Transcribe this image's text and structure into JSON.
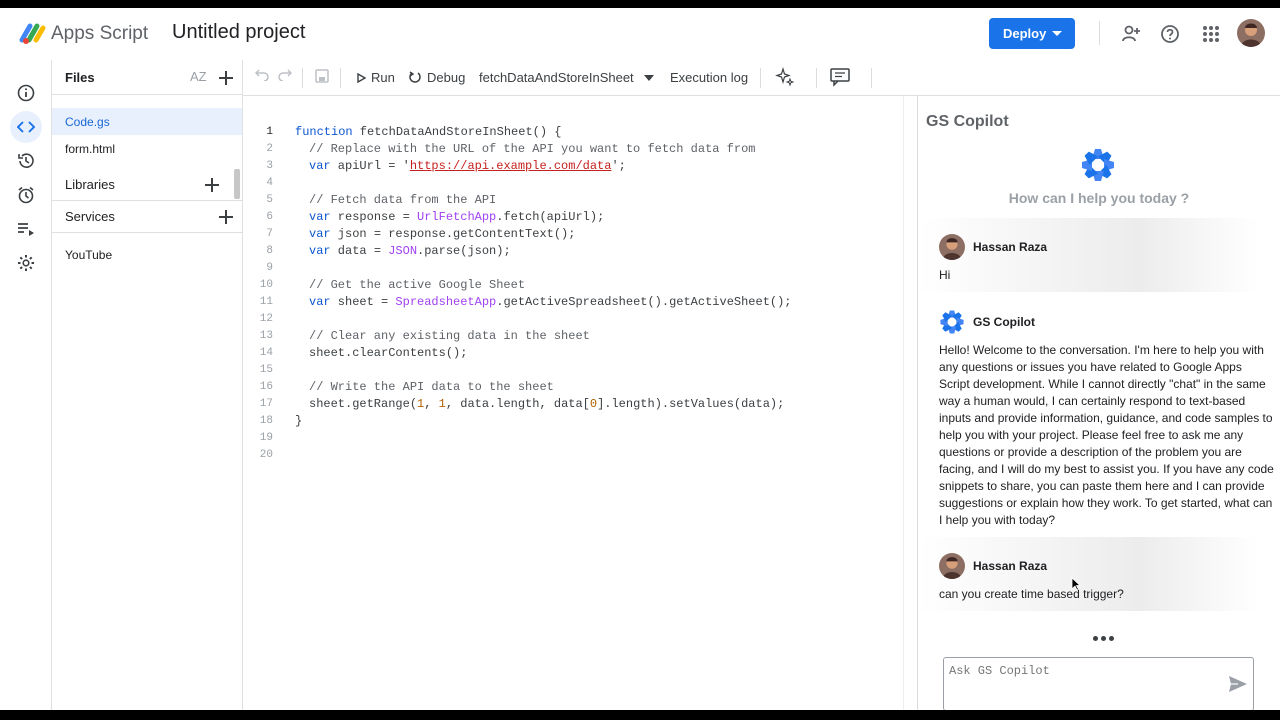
{
  "header": {
    "app_name": "Apps Script",
    "project_title": "Untitled project",
    "deploy_label": "Deploy",
    "icons": [
      "share-person-icon",
      "help-icon",
      "apps-grid-icon",
      "account-avatar"
    ]
  },
  "rail": {
    "items": [
      "info-icon",
      "code-icon",
      "history-icon",
      "triggers-icon",
      "executions-icon",
      "settings-icon"
    ],
    "active": "code-icon"
  },
  "files_panel": {
    "title": "Files",
    "sort_label": "AZ",
    "files": [
      {
        "name": "Code.gs",
        "active": true
      },
      {
        "name": "form.html",
        "active": false
      }
    ],
    "libraries_label": "Libraries",
    "services_label": "Services",
    "services": [
      "YouTube"
    ]
  },
  "toolbar": {
    "run_label": "Run",
    "debug_label": "Debug",
    "function_select": "fetchDataAndStoreInSheet",
    "execution_log_label": "Execution log"
  },
  "editor": {
    "current_line": 1,
    "line_numbers": [
      "1",
      "2",
      "3",
      "4",
      "5",
      "6",
      "7",
      "8",
      "9",
      "10",
      "11",
      "12",
      "13",
      "14",
      "15",
      "16",
      "17",
      "18",
      "19",
      "20"
    ],
    "tokens": {
      "l1_kw": "function",
      "l1_rest": " fetchDataAndStoreInSheet() {",
      "l2": "// Replace with the URL of the API you want to fetch data from",
      "l3_kw": "var",
      "l3_mid": " apiUrl = '",
      "l3_url": "https://api.example.com/data",
      "l3_end": "';",
      "l5": "// Fetch data from the API",
      "l6_kw": "var",
      "l6_mid": " response = ",
      "l6_cls": "UrlFetchApp",
      "l6_end": ".fetch(apiUrl);",
      "l7_kw": "var",
      "l7_end": " json = response.getContentText();",
      "l8_kw": "var",
      "l8_mid": " data = ",
      "l8_cls": "JSON",
      "l8_end": ".parse(json);",
      "l10": "// Get the active Google Sheet",
      "l11_kw": "var",
      "l11_mid": " sheet = ",
      "l11_cls": "SpreadsheetApp",
      "l11_end": ".getActiveSpreadsheet().getActiveSheet();",
      "l13": "// Clear any existing data in the sheet",
      "l14": "sheet.clearContents();",
      "l16": "// Write the API data to the sheet",
      "l17_a": "sheet.getRange(",
      "l17_n1": "1",
      "l17_b": ", ",
      "l17_n2": "1",
      "l17_c": ", data.length, data[",
      "l17_n3": "0",
      "l17_d": "].length).setValues(data);",
      "l18": "}"
    }
  },
  "copilot": {
    "title": "GS Copilot",
    "help_prompt": "How can I help you today ?",
    "messages": [
      {
        "author": "Hassan Raza",
        "text": "Hi"
      },
      {
        "author": "GS Copilot",
        "text": "Hello! Welcome to the conversation. I'm here to help you with any questions or issues you have related to Google Apps Script development. While I cannot directly \"chat\" in the same way a human would, I can certainly respond to text-based inputs and provide information, guidance, and code samples to help you with your project. Please feel free to ask me any questions or provide a description of the problem you are facing, and I will do my best to assist you. If you have any code snippets to share, you can paste them here and I can provide suggestions or explain how they work. To get started, what can I help you with today?"
      },
      {
        "author": "Hassan Raza",
        "text": "can you create time based trigger?"
      }
    ],
    "input_placeholder": "Ask GS Copilot"
  },
  "colors": {
    "accent": "#1a73e8",
    "active_bg": "#e8f0fe",
    "keyword": "#0b56d0",
    "string_url": "#c5221f",
    "class": "#a142f4",
    "comment": "#5f6368"
  }
}
